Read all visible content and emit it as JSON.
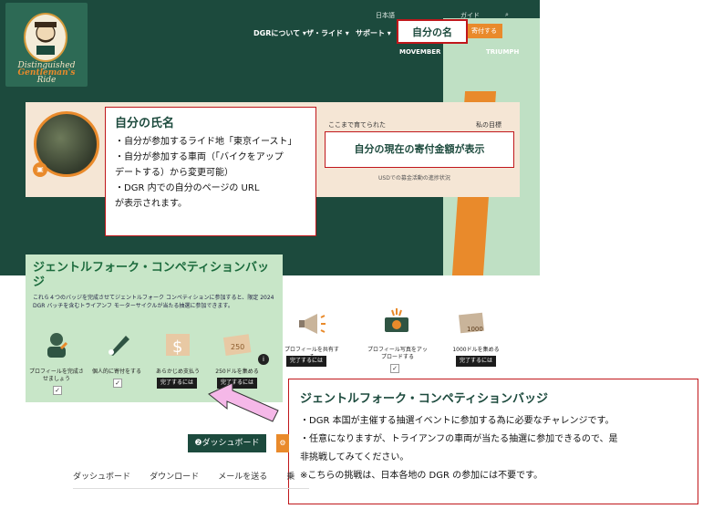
{
  "header": {
    "logo_lines": [
      "Distinguished",
      "Gentleman's",
      "Ride"
    ],
    "topbar_items": [
      "日本語",
      "ガイド",
      "⌕"
    ],
    "nav": [
      "DGRについて ▾",
      "ザ・ライド ▾",
      "サポート ▾"
    ],
    "donate_label": "寄付する",
    "partners": [
      "MOVEMBER",
      "TRIUMPH"
    ]
  },
  "profile": {
    "raised_label": "ここまで育てられた",
    "goal_label": "私の目標",
    "funds_note": "USDでの募金活動の進捗状況"
  },
  "callouts": {
    "name": "自分の名",
    "info_title": "自分の氏名",
    "info_lines": [
      "・自分が参加するライド地「東京イースト」",
      "・自分が参加する車両（「バイクをアップ",
      "デートする）から変更可能）",
      "・DGR 内での自分のページの URL",
      "が表示されます。"
    ],
    "amount": "自分の現在の寄付金額が表示",
    "badge_title": "ジェントルフォーク・コンペティションバッジ",
    "badge_lines": [
      "・DGR 本国が主催する抽選イベントに参加する為に必要なチャレンジです。",
      "・任意になりますが、トライアンフの車両が当たる抽選に参加できるので、是",
      "非挑戦してみてください。",
      "※こちらの挑戦は、日本各地の DGR の参加には不要です。"
    ]
  },
  "badges": {
    "heading": "ジェントルフォーク・コンペティションバッジ",
    "description": "これら４つのバッジを完成させてジェントルフォーク コンペティションに参加すると、限定 2024 DGR バッチを含むトライアンフ モーターサイクルが当たる抽選に参加できます。",
    "items": [
      {
        "label": "プロフィールを完成させましょう",
        "action": "✓",
        "icon": "person-badge-icon"
      },
      {
        "label": "個人的に寄付をする",
        "action": "✓",
        "icon": "pen-badge-icon"
      },
      {
        "label": "あらかじめ支払う",
        "action": "完了するには",
        "icon": "coin-badge-icon"
      },
      {
        "label": "250ドルを集める",
        "action": "完了するには",
        "icon": "bill-250-icon"
      },
      {
        "label": "プロフィールを共有する",
        "action": "完了するには",
        "icon": "megaphone-icon"
      },
      {
        "label": "プロフィール写真をアップロードする",
        "action": "✓",
        "icon": "camera-badge-icon"
      },
      {
        "label": "1000ドルを集める",
        "action": "完了するには",
        "icon": "bill-1000-icon"
      }
    ]
  },
  "dashboard": {
    "dashboard_btn": "❷ダッシュボード",
    "settings_btn": "⚙"
  },
  "tabs": [
    "ダッシュボード",
    "ダウンロード",
    "メールを送る",
    "乗"
  ]
}
